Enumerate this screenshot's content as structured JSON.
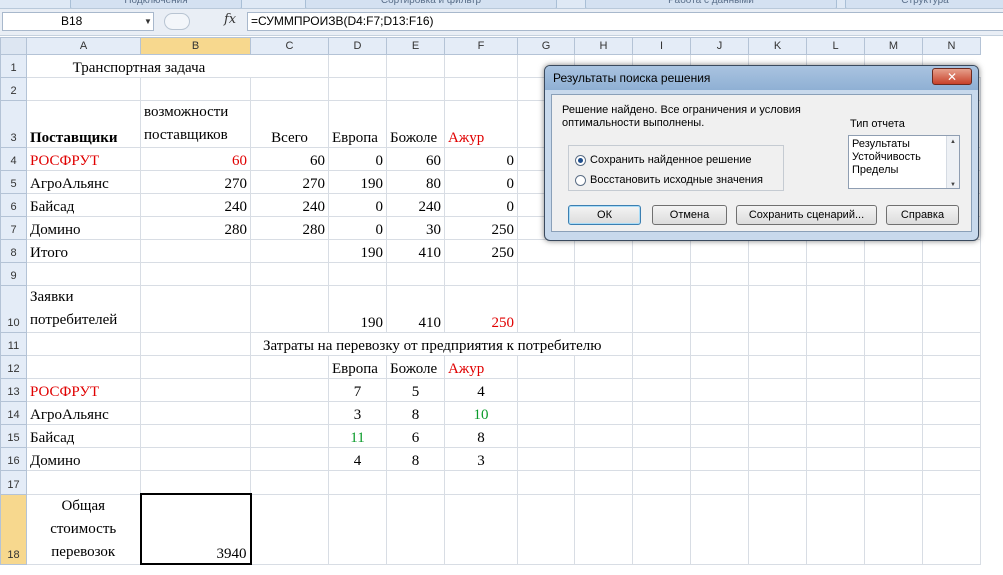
{
  "ribbon": {
    "groups": [
      "Подключения",
      "Сортировка и фильтр",
      "Работа с данными",
      "Структура"
    ]
  },
  "formula_bar": {
    "name_box": "B18",
    "fx_label": "fx",
    "formula": "=СУММПРОИЗВ(D4:F7;D13:F16)"
  },
  "columns": [
    "A",
    "B",
    "C",
    "D",
    "E",
    "F",
    "G",
    "H",
    "I",
    "J",
    "K",
    "L",
    "M",
    "N"
  ],
  "rows_labels": [
    "1",
    "2",
    "3",
    "4",
    "5",
    "6",
    "7",
    "8",
    "9",
    "10",
    "11",
    "12",
    "13",
    "14",
    "15",
    "16",
    "17",
    "18"
  ],
  "sheet": {
    "title": "Транспортная задача",
    "r3": {
      "a": "Поставщики",
      "b": "возможности поставщиков",
      "c": "Всего",
      "d": "Европа",
      "e": "Божоле",
      "f": "Ажур"
    },
    "r4": {
      "a": "РОСФРУТ",
      "b": "60",
      "c": "60",
      "d": "0",
      "e": "60",
      "f": "0"
    },
    "r5": {
      "a": "АгроАльянс",
      "b": "270",
      "c": "270",
      "d": "190",
      "e": "80",
      "f": "0"
    },
    "r6": {
      "a": "Байсад",
      "b": "240",
      "c": "240",
      "d": "0",
      "e": "240",
      "f": "0"
    },
    "r7": {
      "a": "Домино",
      "b": "280",
      "c": "280",
      "d": "0",
      "e": "30",
      "f": "250"
    },
    "r8": {
      "a": "Итого",
      "d": "190",
      "e": "410",
      "f": "250"
    },
    "r10": {
      "a": "Заявки потребителей",
      "d": "190",
      "e": "410",
      "f": "250"
    },
    "r11": {
      "d": "Затраты на перевозку от предприятия к потребителю"
    },
    "r12": {
      "d": "Европа",
      "e": "Божоле",
      "f": "Ажур"
    },
    "r13": {
      "a": "РОСФРУТ",
      "d": "7",
      "e": "5",
      "f": "4"
    },
    "r14": {
      "a": "АгроАльянс",
      "d": "3",
      "e": "8",
      "f": "10"
    },
    "r15": {
      "a": "Байсад",
      "d": "11",
      "e": "6",
      "f": "8"
    },
    "r16": {
      "a": "Домино",
      "d": "4",
      "e": "8",
      "f": "3"
    },
    "r18": {
      "a": "Общая стоимость перевозок",
      "b": "3940"
    }
  },
  "dialog": {
    "title": "Результаты поиска решения",
    "close": "✕",
    "message": "Решение найдено. Все ограничения и условия\nоптимальности выполнены.",
    "report_type_label": "Тип отчета",
    "report_types": [
      "Результаты",
      "Устойчивость",
      "Пределы"
    ],
    "radio_keep": "Сохранить найденное решение",
    "radio_restore": "Восстановить исходные значения",
    "buttons": {
      "ok": "ОК",
      "cancel": "Отмена",
      "save_scenario": "Сохранить сценарий...",
      "help": "Справка"
    }
  },
  "colors": {
    "red": "#e00000",
    "green": "#0a9b2a",
    "selection": "#f7d88e"
  }
}
